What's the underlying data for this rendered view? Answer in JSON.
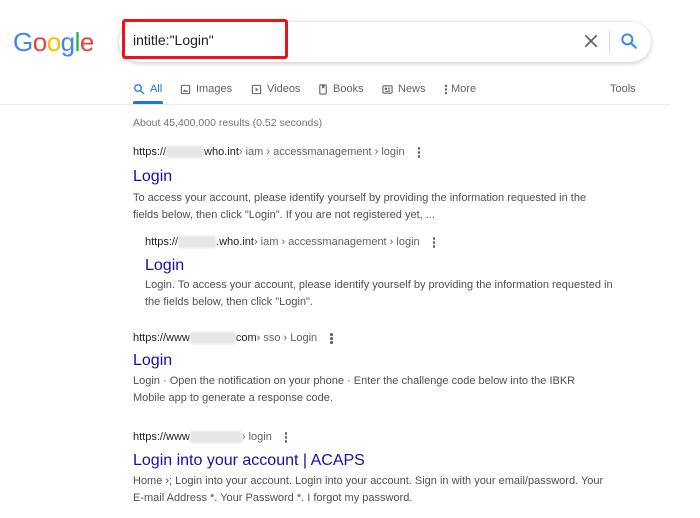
{
  "logo": {
    "letters": [
      "G",
      "o",
      "o",
      "g",
      "l",
      "e"
    ],
    "colors": [
      "#4285f4",
      "#ea4335",
      "#fbbc05",
      "#4285f4",
      "#34a853",
      "#ea4335"
    ]
  },
  "search": {
    "query": "intitle:\"Login\"",
    "clear_icon": "close-icon",
    "search_icon": "search-icon",
    "highlight_color": "#e8131b"
  },
  "tabs": [
    {
      "label": "All",
      "icon": "search-icon",
      "active": true
    },
    {
      "label": "Images",
      "icon": "image-icon",
      "active": false
    },
    {
      "label": "Videos",
      "icon": "play-icon",
      "active": false
    },
    {
      "label": "Books",
      "icon": "book-icon",
      "active": false
    },
    {
      "label": "News",
      "icon": "newspaper-icon",
      "active": false
    },
    {
      "label": "More",
      "icon": "kebab-icon",
      "active": false
    }
  ],
  "tools_label": "Tools",
  "stats": "About 45,400,000 results (0.52 seconds)",
  "results": [
    {
      "url_prefix": "https://",
      "url_domain": "who.int",
      "url_path": " › iam › accessmanagement › login",
      "title": "Login",
      "snippet_line1": "To access your account, please identify yourself by providing the information requested in the",
      "snippet_line2": "fields below, then click \"Login\". If you are not registered yet, ..."
    },
    {
      "url_prefix": "https://",
      "url_domain": ".who.int",
      "url_path": " › iam › accessmanagement › login",
      "title": "Login",
      "snippet_line1": "Login. To access your account, please identify yourself by providing the information requested in",
      "snippet_line2": "the fields below, then click \"Login\"."
    },
    {
      "url_prefix": "https://www",
      "url_domain": "com",
      "url_path": " › sso › Login",
      "title": "Login",
      "snippet_line1": "Login · Open the notification on your phone · Enter the challenge code below into the IBKR",
      "snippet_line2": "Mobile app to generate a response code."
    },
    {
      "url_prefix": "https://www",
      "url_domain": "",
      "url_path": "› login",
      "title": "Login into your account | ACAPS",
      "snippet_line1": "Home ›; Login into your account. Login into your account. Sign in with your email/password. Your",
      "snippet_line2": "E-mail Address *. Your Password *. I forgot my password."
    }
  ]
}
